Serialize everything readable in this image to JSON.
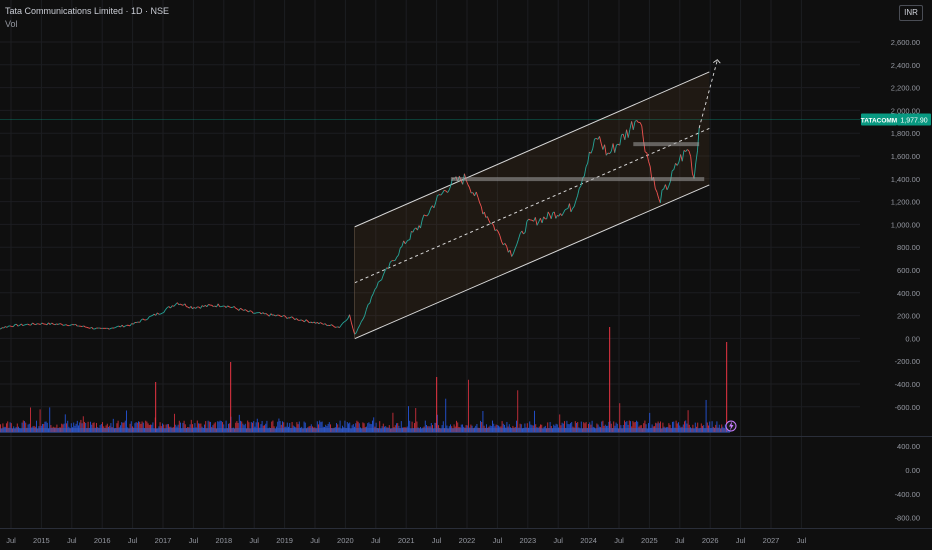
{
  "header": {
    "title": "Tata Communications Limited · 1D · NSE",
    "vol_label": "Vol"
  },
  "currency_button": "INR",
  "price_label": {
    "ticker": "TATACOMM",
    "value": "1,977.90"
  },
  "colors": {
    "up": "#26a69a",
    "down": "#ef5350",
    "price_tag": "#089981",
    "volume_up": "#2962ff",
    "volume_down": "#f23645"
  },
  "lightning_icon": "lightning-icon",
  "chart_data": {
    "type": "line",
    "title": "Tata Communications Limited · 1D · NSE",
    "y_ticks": [
      "2,600.00",
      "2,400.00",
      "2,200.00",
      "2,000.00",
      "1,800.00",
      "1,600.00",
      "1,400.00",
      "1,200.00",
      "1,000.00",
      "800.00",
      "600.00",
      "400.00",
      "200.00",
      "0.00",
      "-200.00",
      "-400.00",
      "-600.00"
    ],
    "volume_ticks": [
      "400.00",
      "0.00",
      "-400.00",
      "-800.00"
    ],
    "x_ticks": [
      "Jul",
      "2015",
      "Jul",
      "2016",
      "Jul",
      "2017",
      "Jul",
      "2018",
      "Jul",
      "2019",
      "Jul",
      "2020",
      "Jul",
      "2021",
      "Jul",
      "2022",
      "Jul",
      "2023",
      "Jul",
      "2024",
      "Jul",
      "2025",
      "Jul",
      "2026",
      "Jul",
      "2027",
      "Jul"
    ],
    "ylim": [
      -600,
      2650
    ],
    "series": [
      {
        "x": [
          "2014-01",
          "2014-07",
          "2015-01",
          "2015-07",
          "2016-01",
          "2016-07",
          "2017-01",
          "2017-04",
          "2017-07",
          "2018-01",
          "2018-07",
          "2019-01",
          "2019-07",
          "2019-12",
          "2020-02",
          "2020-03",
          "2020-05",
          "2020-07",
          "2020-10",
          "2021-01",
          "2021-04",
          "2021-07",
          "2021-10",
          "2022-01",
          "2022-04",
          "2022-07",
          "2022-10",
          "2023-01",
          "2023-04",
          "2023-07",
          "2023-10",
          "2024-01",
          "2024-03",
          "2024-05",
          "2024-07",
          "2024-09",
          "2024-11",
          "2025-01",
          "2025-03",
          "2025-05",
          "2025-07",
          "2025-09",
          "2025-10",
          "2025-11"
        ],
        "values": [
          220,
          280,
          300,
          290,
          250,
          290,
          400,
          480,
          440,
          460,
          390,
          360,
          310,
          270,
          370,
          200,
          380,
          600,
          800,
          1000,
          1150,
          1350,
          1500,
          1550,
          1300,
          1100,
          900,
          1150,
          1200,
          1250,
          1300,
          1700,
          1900,
          1750,
          1850,
          1950,
          2100,
          1700,
          1350,
          1500,
          1700,
          1800,
          1550,
          1977.9
        ]
      }
    ],
    "channel": {
      "start": "2020-03",
      "end": "2026-01",
      "upper": [
        1130,
        2460
      ],
      "lower": [
        170,
        1490
      ],
      "mid": [
        650,
        1975
      ]
    },
    "levels": [
      {
        "start": "2021-10",
        "end": "2025-12",
        "value": 1540
      },
      {
        "start": "2024-10",
        "end": "2025-11",
        "value": 1840
      }
    ],
    "grid": true,
    "legend": "none"
  }
}
